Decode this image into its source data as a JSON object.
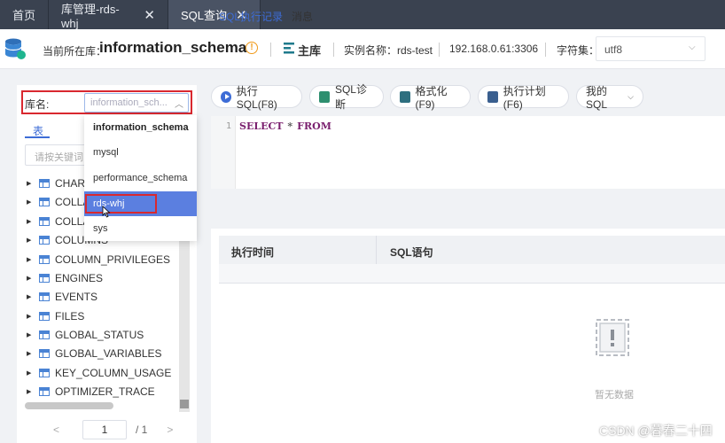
{
  "tabs": [
    {
      "label": "首页"
    },
    {
      "label": "库管理-rds-whj",
      "close": "✕"
    },
    {
      "label": "SQL查询",
      "close": "✕"
    }
  ],
  "header": {
    "location_label": "当前所在库：",
    "database": "information_schema",
    "info_icon": "!",
    "role": "主库",
    "instance": "实例名称：rds-test",
    "address": "192.168.0.61:3306",
    "charset_label": "字符集：",
    "charset_value": "utf8"
  },
  "left": {
    "db_label": "库名:",
    "db_select_value": "information_sch...",
    "tab_tables": "表",
    "search_placeholder": "请按关键词",
    "tables": [
      "CHARA",
      "COLLA",
      "COLLA",
      "COLUMNS",
      "COLUMN_PRIVILEGES",
      "ENGINES",
      "EVENTS",
      "FILES",
      "GLOBAL_STATUS",
      "GLOBAL_VARIABLES",
      "KEY_COLUMN_USAGE",
      "OPTIMIZER_TRACE"
    ],
    "pager": {
      "prev": "<",
      "page": "1",
      "total": "/ 1",
      "next": ">"
    }
  },
  "dropdown": {
    "options": [
      "information_schema",
      "mysql",
      "performance_schema",
      "rds-whj",
      "sys"
    ],
    "selected": "information_schema",
    "hovered": "rds-whj"
  },
  "toolbar": {
    "run": "执行SQL(F8)",
    "diagnose": "SQL诊断",
    "format": "格式化(F9)",
    "plan": "执行计划(F6)",
    "my_sql": "我的SQL"
  },
  "editor": {
    "line": "1",
    "kw1": "SELECT",
    "star": "*",
    "kw2": "FROM"
  },
  "results": {
    "tab_history": "SQL执行记录",
    "tab_messages": "消息",
    "col_time": "执行时间",
    "col_sql": "SQL语句",
    "empty": "暂无数据"
  },
  "watermark": "CSDN @暮春二十四",
  "colors": {
    "accent": "#3d6cd6",
    "highlight": "#d9282f",
    "tabbar": "#3a4250"
  }
}
